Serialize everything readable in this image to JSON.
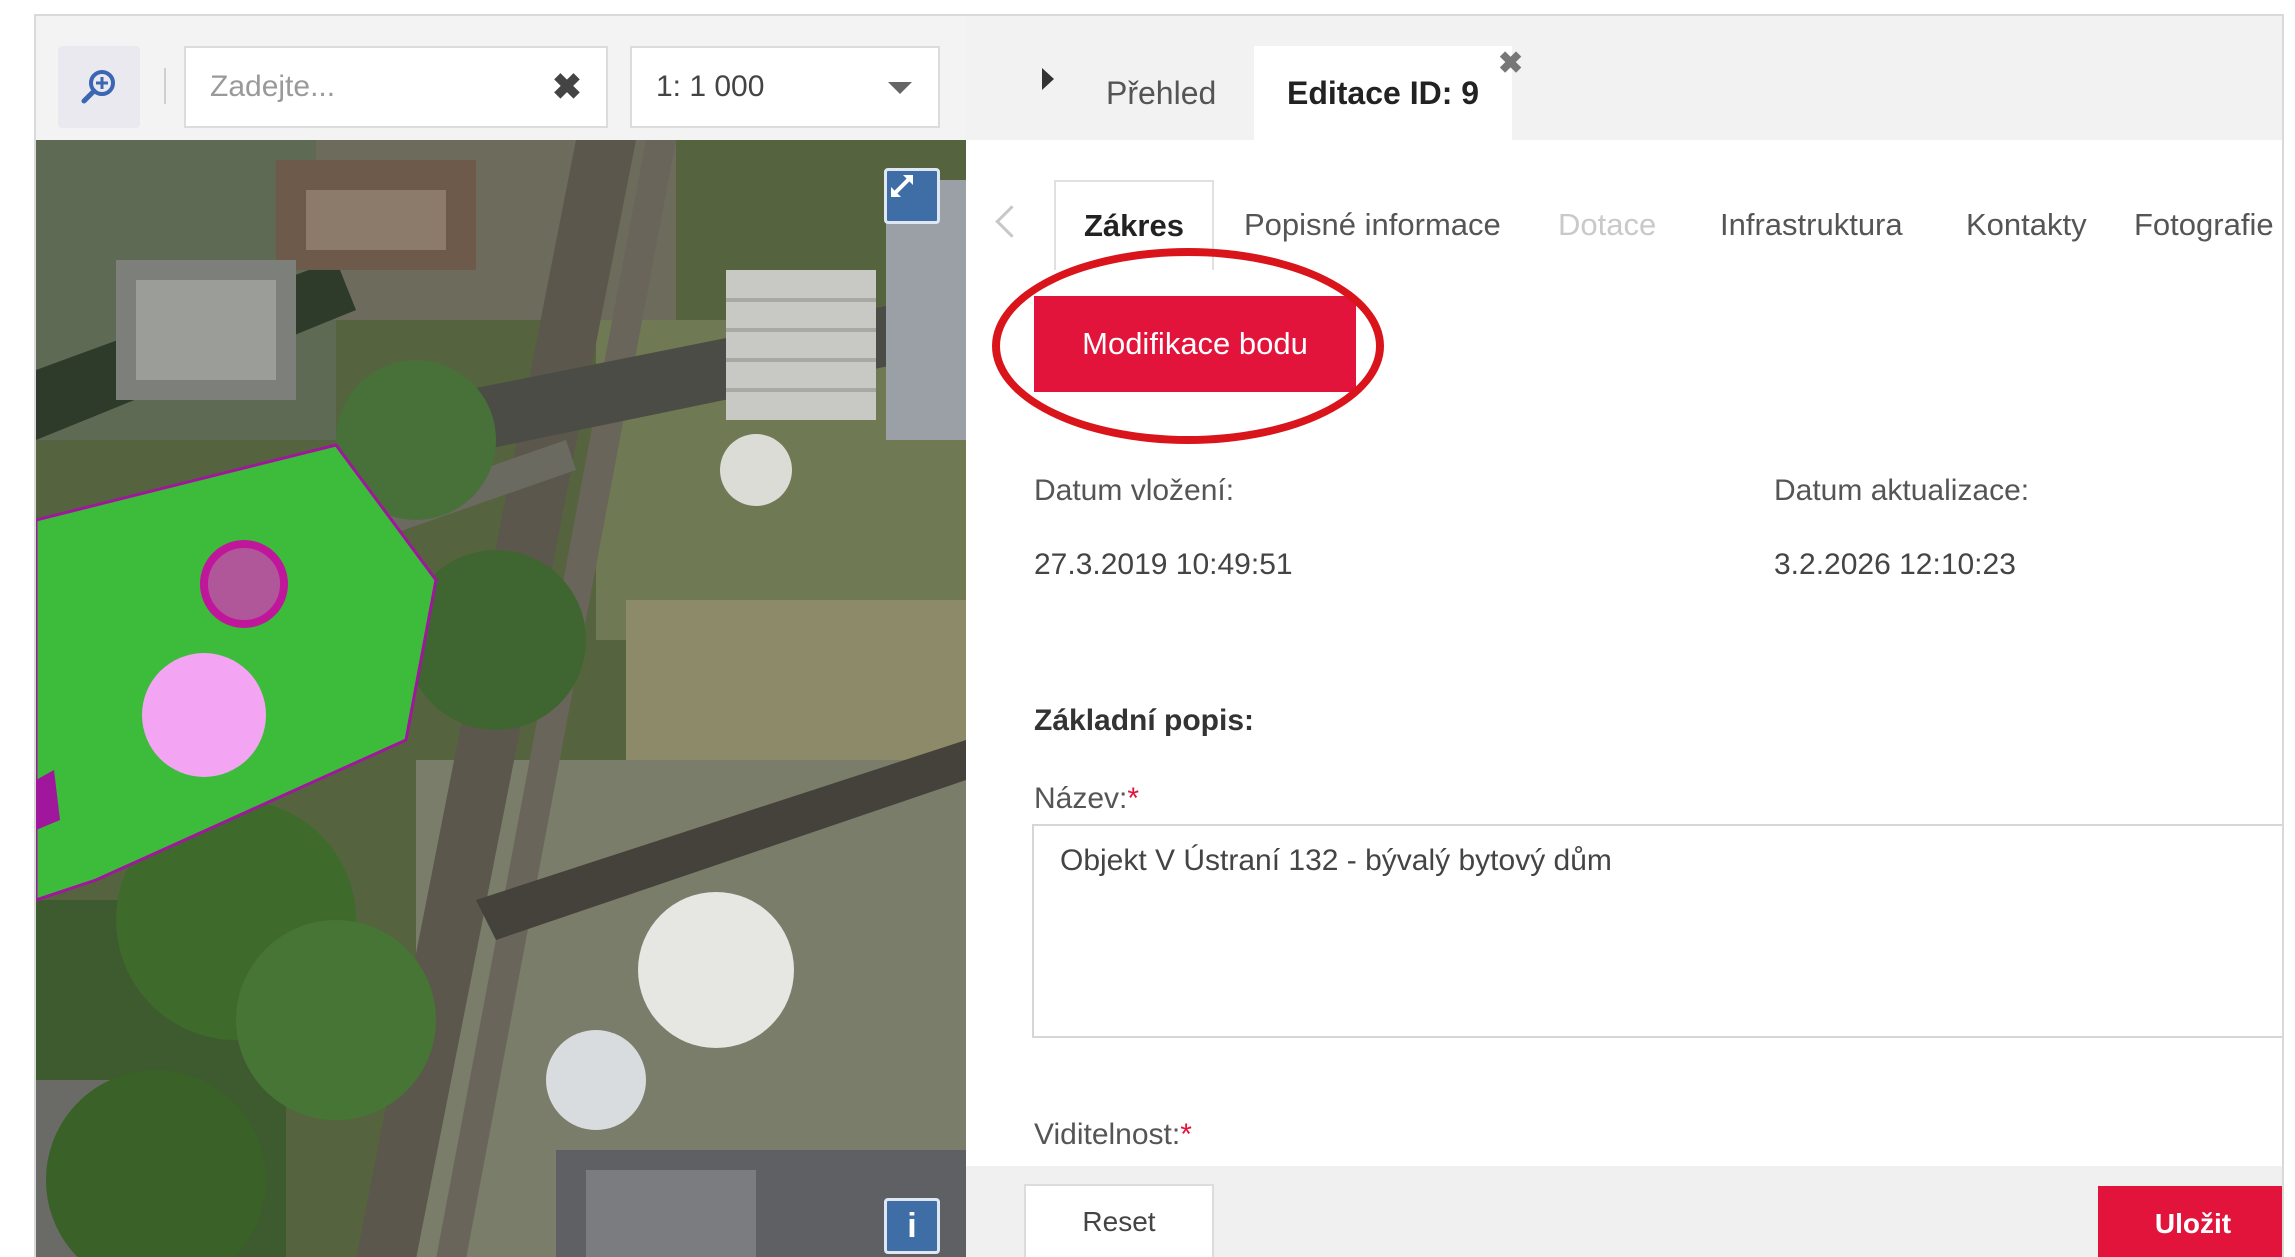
{
  "toolbar": {
    "search_icon": "search-zoom-icon",
    "search_placeholder": "Zadejte...",
    "clear_icon": "close-icon",
    "scale_value": "1: 1 000"
  },
  "map": {
    "fullscreen_icon": "expand-icon",
    "info_label": "i",
    "colors": {
      "parcel": "#3dbb3a",
      "parcel_border": "#a0169c",
      "point": "#f3a4f2",
      "point_ring": "#c0169c"
    }
  },
  "tabs": {
    "overview": "Přehled",
    "edit": "Editace ID: 9",
    "close": "✖"
  },
  "subtabs": [
    "Zákres",
    "Popisné informace",
    "Dotace",
    "Infrastruktura",
    "Kontakty",
    "Fotografie"
  ],
  "form": {
    "modify_button": "Modifikace bodu",
    "created_label": "Datum vložení:",
    "created_value": "27.3.2019 10:49:51",
    "updated_label": "Datum aktualizace:",
    "updated_value": "3.2.2026 12:10:23",
    "basic_section": "Základní popis:",
    "name_label": "Název:",
    "name_required": "*",
    "name_value": "Objekt V Ústraní 132 - bývalý bytový dům",
    "visibility_label": "Viditelnost:",
    "visibility_required": "*"
  },
  "footer": {
    "reset": "Reset",
    "save": "Uložit"
  },
  "colors": {
    "accent": "#e3143c",
    "highlight_ring": "#d9141b"
  }
}
